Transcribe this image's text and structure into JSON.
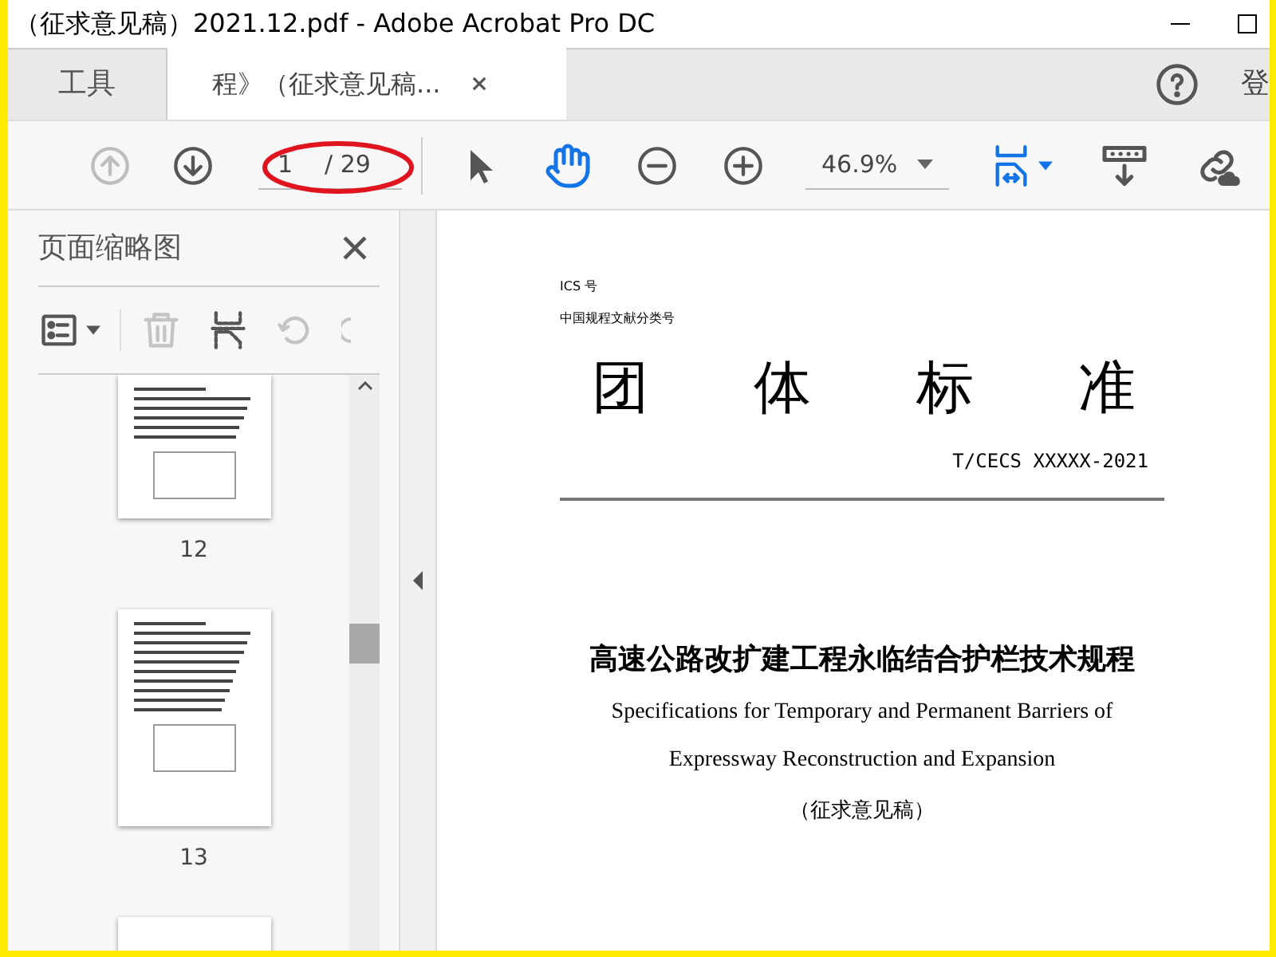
{
  "window": {
    "title": "（征求意见稿）2021.12.pdf - Adobe Acrobat Pro DC"
  },
  "tabs": [
    {
      "label": "工具",
      "selected": false
    },
    {
      "label": "程》（征求意见稿...",
      "selected": true
    }
  ],
  "account": {
    "label": "登"
  },
  "toolbar": {
    "nav": [
      {
        "kind": "previous",
        "disabled": true
      },
      {
        "kind": "next",
        "disabled": false
      }
    ],
    "page": {
      "value": "1",
      "total": "/ 29"
    },
    "tools": [
      {
        "kind": "select",
        "selected": false
      },
      {
        "kind": "hand",
        "selected": true
      }
    ],
    "zoom": {
      "value": "46.9%"
    }
  },
  "sidebar": {
    "title": "页面缩略图",
    "tools": [
      {
        "kind": "options",
        "disabled": false
      },
      {
        "kind": "delete",
        "disabled": true
      },
      {
        "kind": "insert",
        "disabled": false
      },
      {
        "kind": "rotate_left",
        "disabled": true
      },
      {
        "kind": "rotate_right",
        "disabled": true
      }
    ],
    "thumbnails": [
      {
        "label": "12"
      },
      {
        "label": "13"
      }
    ]
  },
  "document": {
    "ics": "ICS 号",
    "classification": "中国规程文献分类号",
    "heading": [
      "团",
      "体",
      "标",
      "准"
    ],
    "code": "T/CECS XXXXX-2021",
    "title_cn": "高速公路改扩建工程永临结合护栏技术规程",
    "title_en": [
      "Specifications for Temporary and Permanent Barriers of",
      "Expressway Reconstruction and Expansion"
    ],
    "stage": "（征求意见稿）"
  }
}
